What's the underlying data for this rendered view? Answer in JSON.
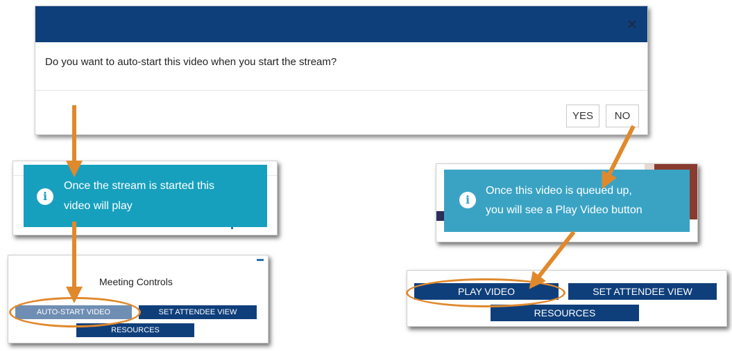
{
  "modal": {
    "question": "Do you want to auto-start this video when you start the stream?",
    "yes_label": "YES",
    "no_label": "NO",
    "close_icon": "close-icon",
    "header_color": "#0f3f7b"
  },
  "left_toast": {
    "line1": "Once the stream is started this",
    "line2": "video will play",
    "icon": "info-icon",
    "color": "#17a0bd"
  },
  "left_controls": {
    "title": "Meeting Controls",
    "auto_start_label": "AUTO-START VIDEO",
    "set_attendee_view_label": "SET ATTENDEE VIEW",
    "resources_label": "RESOURCES",
    "minimize_icon": "minimize-icon"
  },
  "right_toast": {
    "line1": "Once this video is queued up,",
    "line2": "you will see a Play Video button",
    "icon": "info-icon",
    "color": "#3aa3c4"
  },
  "right_controls": {
    "play_video_label": "PLAY VIDEO",
    "set_attendee_view_label": "SET ATTENDEE VIEW",
    "resources_label": "RESOURCES"
  },
  "annotation_color": "#e0892c"
}
